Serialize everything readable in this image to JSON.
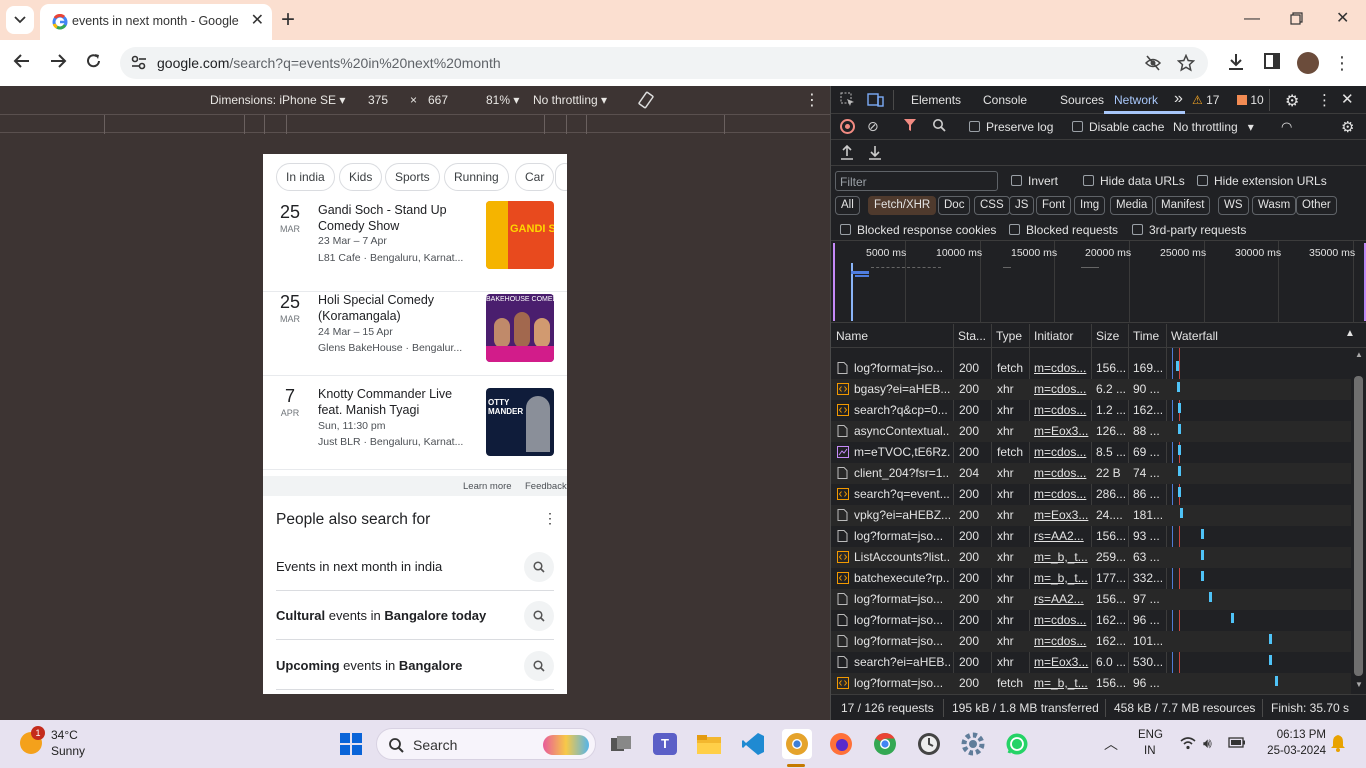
{
  "browser": {
    "tab_title": "events in next month - Google Search",
    "url_host": "google.com",
    "url_rest": "/search?q=events%20in%20next%20month",
    "colors": {
      "tabstrip": "#fbdfd0",
      "accent": "#1a73e8"
    }
  },
  "device_toolbar": {
    "dimensions_label": "Dimensions: iPhone SE",
    "width": "375",
    "times": "×",
    "height": "667",
    "zoom": "81%",
    "throttling": "No throttling"
  },
  "page": {
    "chips": [
      "In india",
      "Kids",
      "Sports",
      "Running",
      "Car"
    ],
    "events": [
      {
        "day": "25",
        "month": "MAR",
        "name": "Gandi Soch - Stand Up Comedy Show",
        "date": "23 Mar – 7 Apr",
        "venue": "L81 Cafe · Bengaluru, Karnat...",
        "image_text": "GANDI SO"
      },
      {
        "day": "25",
        "month": "MAR",
        "name": "Holi Special Comedy (Koramangala)",
        "date": "24 Mar – 15 Apr",
        "venue": "Glens BakeHouse · Bengalur...",
        "image_text": "BAKEHOUSE COMEDY"
      },
      {
        "day": "7",
        "month": "APR",
        "name": "Knotty Commander Live feat. Manish Tyagi",
        "date": "Sun, 11:30 pm",
        "venue": "Just BLR · Bengaluru, Karnat...",
        "image_text": "OTTY MANDER"
      }
    ],
    "learn_more": "Learn more",
    "feedback": "Feedback",
    "pasf_title": "People also search for",
    "pasf_items": [
      {
        "pre": "",
        "b1": "",
        "mid": "Events in next month in india",
        "b2": ""
      },
      {
        "pre": "",
        "b1": "Cultural",
        "mid": " events in ",
        "b2": "Bangalore today"
      },
      {
        "pre": "",
        "b1": "Upcoming",
        "mid": " events in ",
        "b2": "Bangalore"
      }
    ]
  },
  "devtools": {
    "tabs": [
      "Elements",
      "Console",
      "Sources",
      "Network"
    ],
    "active_tab": "Network",
    "more": "»",
    "warnings": "17",
    "issues": "10",
    "preserve_log": "Preserve log",
    "disable_cache": "Disable cache",
    "throttling": "No throttling",
    "filter_placeholder": "Filter",
    "invert": "Invert",
    "hide_data_urls": "Hide data URLs",
    "hide_extension_urls": "Hide extension URLs",
    "filter_types": [
      "All",
      "Fetch/XHR",
      "Doc",
      "CSS",
      "JS",
      "Font",
      "Img",
      "Media",
      "Manifest",
      "WS",
      "Wasm",
      "Other"
    ],
    "active_filter": "Fetch/XHR",
    "blocked_response_cookies": "Blocked response cookies",
    "blocked_requests": "Blocked requests",
    "third_party": "3rd-party requests",
    "overview_ticks": [
      "5000 ms",
      "10000 ms",
      "15000 ms",
      "20000 ms",
      "25000 ms",
      "30000 ms",
      "35000 ms"
    ],
    "columns": [
      "Name",
      "Sta...",
      "Type",
      "Initiator",
      "Size",
      "Time",
      "Waterfall"
    ],
    "requests": [
      {
        "icon": "doc",
        "name": "log?format=jso...",
        "status": "200",
        "type": "fetch",
        "initiator": "m=cdos...",
        "size": "156...",
        "time": "169...",
        "wf": 0.02
      },
      {
        "icon": "code",
        "name": "bgasy?ei=aHEB...",
        "status": "200",
        "type": "xhr",
        "initiator": "m=cdos...",
        "size": "6.2 ...",
        "time": "90 ...",
        "wf": 0.025
      },
      {
        "icon": "code",
        "name": "search?q&cp=0...",
        "status": "200",
        "type": "xhr",
        "initiator": "m=cdos...",
        "size": "1.2 ...",
        "time": "162...",
        "wf": 0.03
      },
      {
        "icon": "doc",
        "name": "asyncContextual...",
        "status": "200",
        "type": "xhr",
        "initiator": "m=Eox3...",
        "size": "126...",
        "time": "88 ...",
        "wf": 0.03
      },
      {
        "icon": "img",
        "name": "m=eTVOC,tE6Rz...",
        "status": "200",
        "type": "fetch",
        "initiator": "m=cdos...",
        "size": "8.5 ...",
        "time": "69 ...",
        "wf": 0.03
      },
      {
        "icon": "doc",
        "name": "client_204?fsr=1...",
        "status": "204",
        "type": "xhr",
        "initiator": "m=cdos...",
        "size": "22 B",
        "time": "74 ...",
        "wf": 0.03
      },
      {
        "icon": "code",
        "name": "search?q=event...",
        "status": "200",
        "type": "xhr",
        "initiator": "m=cdos...",
        "size": "286...",
        "time": "86 ...",
        "wf": 0.03
      },
      {
        "icon": "doc",
        "name": "vpkg?ei=aHEBZ...",
        "status": "200",
        "type": "xhr",
        "initiator": "m=Eox3...",
        "size": "24....",
        "time": "181...",
        "wf": 0.04
      },
      {
        "icon": "doc",
        "name": "log?format=jso...",
        "status": "200",
        "type": "xhr",
        "initiator": "rs=AA2...",
        "size": "156...",
        "time": "93 ...",
        "wf": 0.17
      },
      {
        "icon": "code",
        "name": "ListAccounts?list...",
        "status": "200",
        "type": "xhr",
        "initiator": "m=_b,_t...",
        "size": "259...",
        "time": "63 ...",
        "wf": 0.17
      },
      {
        "icon": "code",
        "name": "batchexecute?rp...",
        "status": "200",
        "type": "xhr",
        "initiator": "m=_b,_t...",
        "size": "177...",
        "time": "332...",
        "wf": 0.17
      },
      {
        "icon": "doc",
        "name": "log?format=jso...",
        "status": "200",
        "type": "xhr",
        "initiator": "rs=AA2...",
        "size": "156...",
        "time": "97 ...",
        "wf": 0.22
      },
      {
        "icon": "doc",
        "name": "log?format=jso...",
        "status": "200",
        "type": "xhr",
        "initiator": "m=cdos...",
        "size": "162...",
        "time": "96 ...",
        "wf": 0.35
      },
      {
        "icon": "doc",
        "name": "log?format=jso...",
        "status": "200",
        "type": "xhr",
        "initiator": "m=cdos...",
        "size": "162...",
        "time": "101...",
        "wf": 0.58
      },
      {
        "icon": "doc",
        "name": "search?ei=aHEB...",
        "status": "200",
        "type": "xhr",
        "initiator": "m=Eox3...",
        "size": "6.0 ...",
        "time": "530...",
        "wf": 0.58
      },
      {
        "icon": "code",
        "name": "log?format=jso...",
        "status": "200",
        "type": "fetch",
        "initiator": "m=_b,_t...",
        "size": "156...",
        "time": "96 ...",
        "wf": 0.62
      }
    ],
    "status": {
      "requests": "17 / 126 requests",
      "transferred": "195 kB / 1.8 MB transferred",
      "resources": "458 kB / 7.7 MB resources",
      "finish": "Finish: 35.70 s"
    }
  },
  "taskbar": {
    "weather_temp": "34°C",
    "weather_desc": "Sunny",
    "weather_badge": "1",
    "search": "Search",
    "lang1": "ENG",
    "lang2": "IN",
    "time": "06:13 PM",
    "date": "25-03-2024"
  }
}
